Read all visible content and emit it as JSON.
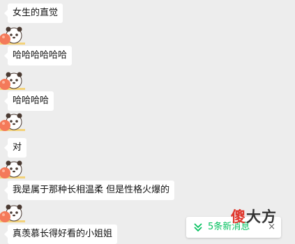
{
  "messages": [
    {
      "text": "女生的直觉"
    },
    {
      "text": "哈哈哈哈哈哈"
    },
    {
      "text": "哈哈哈哈"
    },
    {
      "text": "对"
    },
    {
      "text": "我是属于那种长相温柔 但是性格火爆的"
    },
    {
      "text": "真羡慕长得好看的小姐姐"
    }
  ],
  "new_messages": {
    "label": "5条新消息",
    "close_glyph": "×",
    "icon": "double-chevron-down-icon",
    "color": "#07c160"
  },
  "watermark": {
    "char1": "傻",
    "char2": "大方"
  },
  "colors": {
    "background": "#ededed",
    "bubble": "#ffffff",
    "accent_green": "#07c160",
    "watermark_red": "#e0362c"
  },
  "avatar_icon": "panda-bear-holding-peach-avatar"
}
